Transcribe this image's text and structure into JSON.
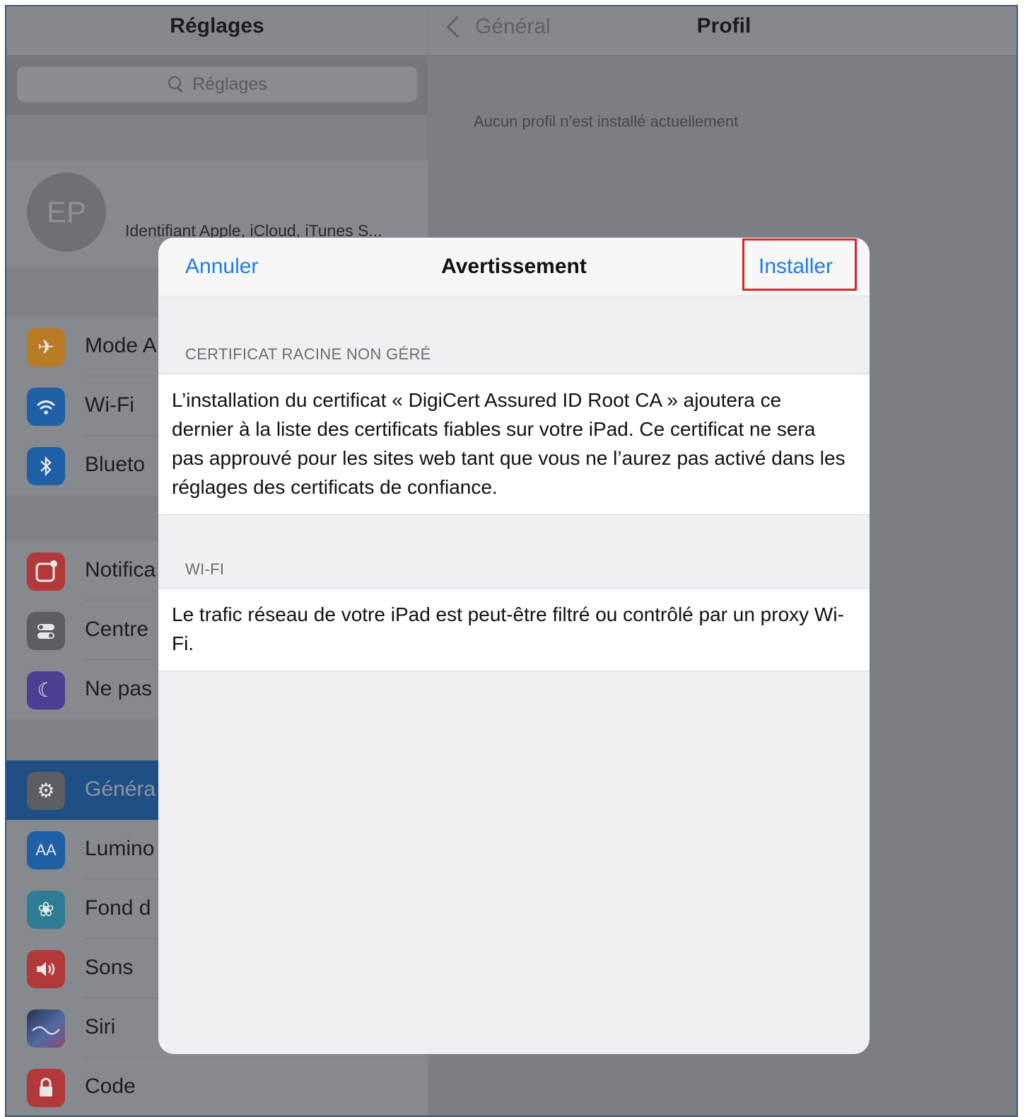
{
  "sidebar": {
    "title": "Réglages",
    "search_placeholder": "Réglages",
    "account": {
      "initials": "EP",
      "subtitle": "Identifiant Apple, iCloud, iTunes S..."
    },
    "group1": [
      {
        "label": "Mode A",
        "icon": "airplane-icon",
        "color": "#b97a25"
      },
      {
        "label": "Wi-Fi",
        "icon": "wifi-icon",
        "color": "#1f5fa6"
      },
      {
        "label": "Blueto",
        "icon": "bluetooth-icon",
        "color": "#1f5fa6"
      }
    ],
    "group2": [
      {
        "label": "Notifica",
        "icon": "notifications-icon",
        "color": "#b2383a"
      },
      {
        "label": "Centre",
        "icon": "control-center-icon",
        "color": "#5b5e63"
      },
      {
        "label": "Ne pas",
        "icon": "moon-icon",
        "color": "#4a3f93"
      }
    ],
    "group3": [
      {
        "label": "Généra",
        "icon": "gear-icon",
        "color": "#5b5e63",
        "selected": true
      },
      {
        "label": "Lumino",
        "icon": "display-brightness-icon",
        "color": "#1f5fa6"
      },
      {
        "label": "Fond d",
        "icon": "wallpaper-icon",
        "color": "#2e7d94"
      },
      {
        "label": "Sons",
        "icon": "speaker-icon",
        "color": "#b2383a"
      },
      {
        "label": "Siri",
        "icon": "siri-icon",
        "color": "#3b3f63"
      },
      {
        "label": "Code",
        "icon": "lock-icon",
        "color": "#b2383a"
      }
    ]
  },
  "detail": {
    "back_label": "Général",
    "title": "Profil",
    "message": "Aucun profil n’est installé actuellement"
  },
  "modal": {
    "cancel_label": "Annuler",
    "title": "Avertissement",
    "install_label": "Installer",
    "highlight_color": "#e0242c",
    "accent_color": "#1d7cf2",
    "sections": [
      {
        "header": "CERTIFICAT RACINE NON GÉRÉ",
        "text": "L’installation du certificat « DigiCert Assured ID Root CA » ajoutera ce dernier à la liste des certificats fiables sur votre iPad. Ce certificat ne sera pas approuvé pour les sites web tant que vous ne l’aurez pas activé dans les réglages des certificats de confiance."
      },
      {
        "header": "WI-FI",
        "text": "Le trafic réseau de votre iPad est peut-être filtré ou contrôlé par un proxy Wi-Fi."
      }
    ]
  }
}
